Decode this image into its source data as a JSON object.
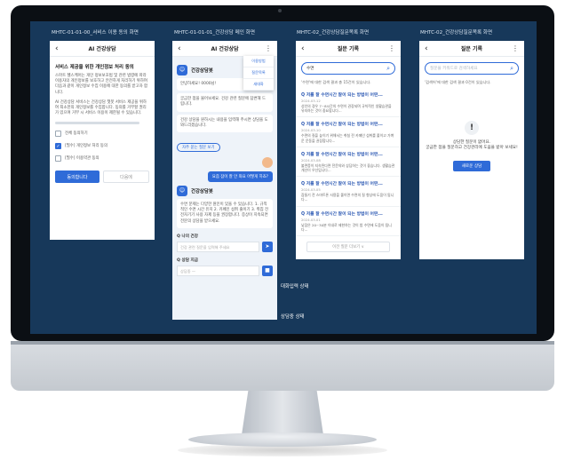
{
  "columns": [
    {
      "title": "MHTC-01-01-00_서비스 이용 동의 화면"
    },
    {
      "title": "MHTC-01-01-01_건강상담 메인 화면"
    },
    {
      "title": "MHTC-02_건강상담질문목록 화면"
    },
    {
      "title": "MHTC-02_건강상담질문목록 화면"
    }
  ],
  "consent": {
    "title": "AI 건강상담",
    "heading": "서비스 제공을 위한 개인정보 처리 동의",
    "para1": "스마트 헬스케어는 개인 정보보호법 및 관련 법령에 따라 이용자의 개인정보를 보호하고 안전하게 처리하기 위하여 다음과 같이 개인정보 수집 이용에 대한 동의를 받고자 합니다.",
    "para2": "AI 건강상담 서비스는 건강상담 챗봇 서비스 제공을 위하여 최소한의 개인정보를 수집합니다. 동의를 거부할 권리가 있으며 거부 시 서비스 이용이 제한될 수 있습니다.",
    "opt_all": "전체 동의하기",
    "opt_1": "[필수] 개인정보 처리 동의",
    "opt_2": "[필수] 이용약관 동의",
    "agree": "동의합니다",
    "cancel": "다음에"
  },
  "chat": {
    "title": "AI 건강상담",
    "menu": [
      "이용방법",
      "질문목록",
      "새대화"
    ],
    "bot_name": "건강상담봇",
    "greet": "안녕하세요! 0000님!",
    "msg1": "궁금한 점을 물어보세요. 건강 관련 질문에 답변해 드립니다.",
    "msg2": "건강 상담을 원하시는 내용을 입력해 주시면 상담을 도와드리겠습니다.",
    "chip": "자주 묻는 질문 보기",
    "user_q": "요즘 잠이 잘 안 와요 어떻게 하죠?",
    "bot_name2": "건강상담봇",
    "answer": "수면 문제는 다양한 원인이 있을 수 있습니다. 1. 규칙적인 수면 시간 유지 2. 카페인 섭취 줄이기 3. 취침 전 전자기기 사용 자제 등을 권장합니다. 증상이 지속되면 전문의 상담을 받으세요.",
    "q_label": "Q 나의 건강",
    "q_placeholder": "건강 관련 질문을 입력해 주세요",
    "r_label": "Q 상담 지금",
    "r_value": "상담중 —",
    "state_typing": "대화입력 상태",
    "state_consult": "상담중 상태"
  },
  "list": {
    "title": "질문 기록",
    "query": "수면",
    "count": "'수면'에 대한 검색 결과 총 15건이 있습니다.",
    "records": [
      {
        "title": "Q 저를 잘 수면시간 잘이 되는 방법이 어떤...",
        "date": "2024.03.12",
        "snippet": "성인의 경우 7~8시간의 수면이 권장되며 규칙적인 생활습관을 유지하는 것이 중요합니다..."
      },
      {
        "title": "Q 저를 잘 수면시간 잘이 되는 방법이 어떤...",
        "date": "2024.03.10",
        "snippet": "수면의 질을 높이기 위해서는 취침 전 카페인 섭취를 줄이고 가벼운 운동을 권장합니다..."
      },
      {
        "title": "Q 저를 잘 수면시간 잘이 되는 방법이 어떤...",
        "date": "2024.03.08",
        "snippet": "불면증이 지속된다면 전문의와 상담하는 것이 좋습니다. 생활습관 개선이 우선입니다..."
      },
      {
        "title": "Q 저를 잘 수면시간 잘이 되는 방법이 어떤...",
        "date": "2024.03.05",
        "snippet": "잠들기 전 스마트폰 사용을 줄이면 수면의 질 향상에 도움이 됩니다..."
      },
      {
        "title": "Q 저를 잘 수면시간 잘이 되는 방법이 어떤...",
        "date": "2024.03.01",
        "snippet": "낮잠은 20~30분 이내로 제한하는 것이 밤 수면에 도움이 됩니다..."
      }
    ],
    "more": "이전 질문 더보기 ∨"
  },
  "empty": {
    "title": "질문 기록",
    "placeholder": "질문을 키워드로 검색하세요",
    "count": "'검색어'에 대한 검색 결과 0건이 있습니다.",
    "msg1": "상담한 질문이 없어요.",
    "msg2": "궁금한 점을 질문하고 건강관리에 도움을 받아 보세요!",
    "cta": "새로운 상담"
  }
}
